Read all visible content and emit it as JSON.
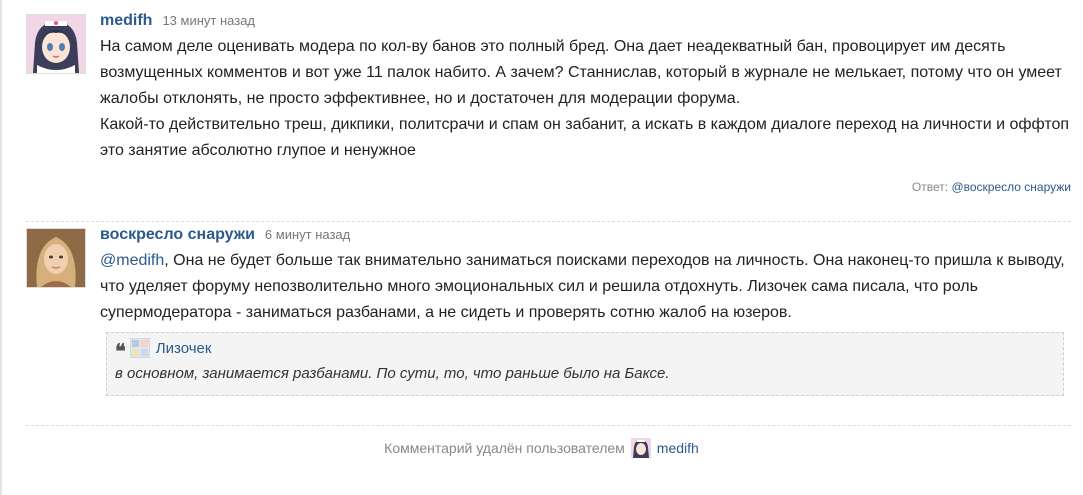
{
  "comments": [
    {
      "author": "medifh",
      "time": "13 минут назад",
      "lines": [
        "На самом деле оценивать модера по кол-ву банов это полный бред. Она дает неадекватный бан, провоцирует им десять возмущенных комментов и вот уже 11 палок набито. А зачем? Станнислав, который в журнале не мелькает, потому что он умеет жалобы отклонять, не просто эффективнее, но и достаточен для модерации форума.",
        "Какой-то действительно треш, дикпики, политсрачи и спам он забанит, а искать в каждом диалоге переход на личности и оффтоп это занятие абсолютно глупое и ненужное"
      ],
      "reply_label": "Ответ:",
      "reply_to": "@воскресло снаружи"
    },
    {
      "author": "воскресло снаружи",
      "time": "6 минут назад",
      "mention": "@medifh",
      "text": ", Она не будет больше так внимательно заниматься поисками переходов на личность. Она наконец-то пришла к выводу, что уделяет форуму непозволительно много эмоциональных сил и решила отдохнуть. Лизочек сама писала, что роль супермодератора - заниматься разбанами, а не сидеть и проверять сотню жалоб на юзеров.",
      "quote": {
        "author": "Лизочек",
        "text": "в основном, занимается разбанами. По сути, то, что раньше было на Баксе."
      }
    }
  ],
  "deleted_notice": {
    "text": "Комментарий удалён пользователем",
    "user": "medifh"
  },
  "colors": {
    "link": "#2b5a8c",
    "muted": "#888888",
    "quote_bg": "#f4f4f4"
  }
}
